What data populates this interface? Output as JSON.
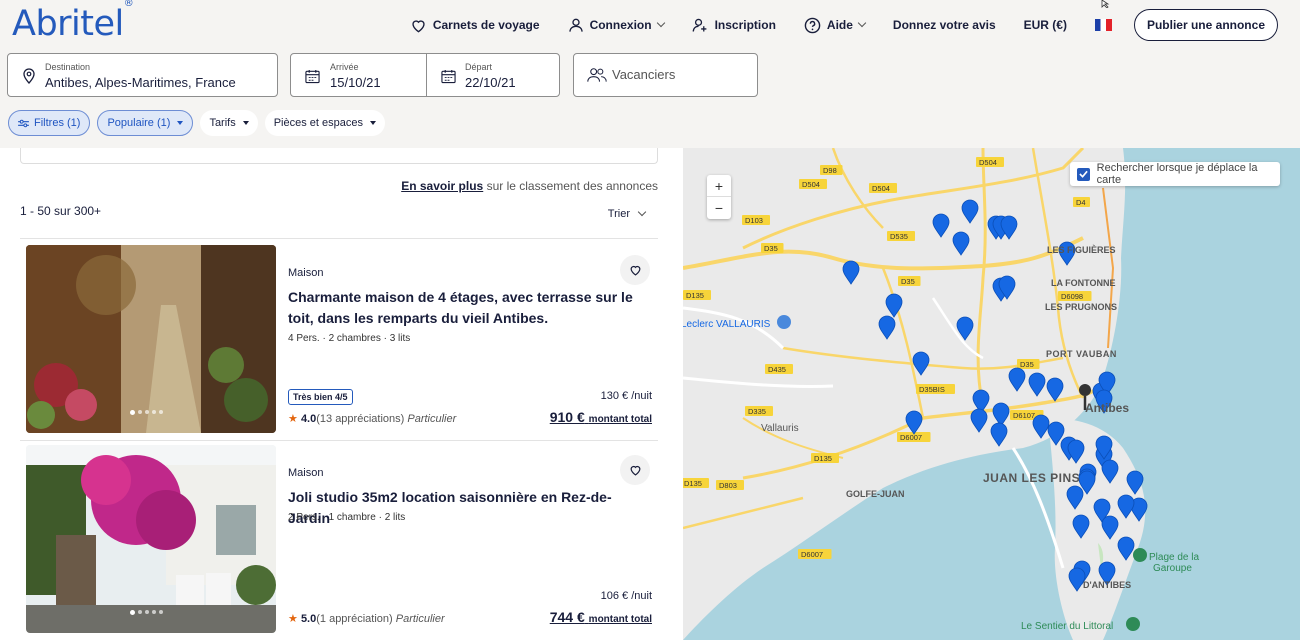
{
  "brand": {
    "logo": "Abritel",
    "reg": "®"
  },
  "topnav": {
    "carnets": "Carnets de voyage",
    "connexion": "Connexion",
    "inscription": "Inscription",
    "aide": "Aide",
    "avis": "Donnez votre avis",
    "currency": "EUR (€)",
    "publish": "Publier une annonce"
  },
  "search": {
    "destination_label": "Destination",
    "destination_value": "Antibes, Alpes-Maritimes, France",
    "arrival_label": "Arrivée",
    "arrival_value": "15/10/21",
    "departure_label": "Départ",
    "departure_value": "22/10/21",
    "guests_placeholder": "Vacanciers"
  },
  "filters": {
    "filtres": "Filtres (1)",
    "populaire": "Populaire (1)",
    "tarifs": "Tarifs",
    "pieces": "Pièces et espaces"
  },
  "results": {
    "learn_more": "En savoir plus",
    "ranking_text": " sur le classement des annonces",
    "count": "1 - 50 sur 300+",
    "sort": "Trier"
  },
  "listings": [
    {
      "type": "Maison",
      "title": "Charmante maison de 4 étages, avec terrasse sur le toit, dans les remparts du vieil Antibes.",
      "meta": "4 Pers. · 2 chambres · 3 lits",
      "badge": "Très bien 4/5",
      "rating": "4.0",
      "reviews": "(13 appréciations)",
      "host": "Particulier",
      "per_night": "130 € /nuit",
      "total": "910 €",
      "total_label": "montant total"
    },
    {
      "type": "Maison",
      "title": "Joli studio 35m2 location saisonnière en Rez-de-Jardin",
      "meta": "2 Pers. · 1 chambre · 2 lits",
      "rating": "5.0",
      "reviews": "(1 appréciation)",
      "host": "Particulier",
      "per_night": "106 € /nuit",
      "total": "744 €",
      "total_label": "montant total"
    }
  ],
  "map": {
    "zoom_in": "+",
    "zoom_out": "−",
    "move_search": "Rechercher lorsque je déplace la carte",
    "places": {
      "antibes": "Antibes",
      "juan": "JUAN LES PINS",
      "vallauris": "Vallauris",
      "golfe": "GOLFE-JUAN",
      "fontonne": "LA FONTONNE",
      "prugnons": "LES PRUGNONS",
      "figuieres": "LES FIGUIÈRES",
      "vauban": "PORT VAUBAN",
      "leclerc": "Leclerc VALLAURIS",
      "garoupe1": "Plage de la",
      "garoupe2": "Garoupe",
      "littoral": "Le Sentier du Littoral",
      "cap": "D'ANTIBES",
      "roads": [
        "D98",
        "D504",
        "D504",
        "D504",
        "D103",
        "D35",
        "D535",
        "D35",
        "D435",
        "D35BIS",
        "D35",
        "D6107",
        "D135",
        "D335",
        "D6007",
        "D135",
        "D803",
        "D6007",
        "D4",
        "D6098",
        "D135"
      ]
    }
  },
  "colors": {
    "brand": "#245abc",
    "pin": "#1668e3",
    "sea": "#aad3df",
    "land": "#eaeaea",
    "road": "#f9d66a"
  }
}
